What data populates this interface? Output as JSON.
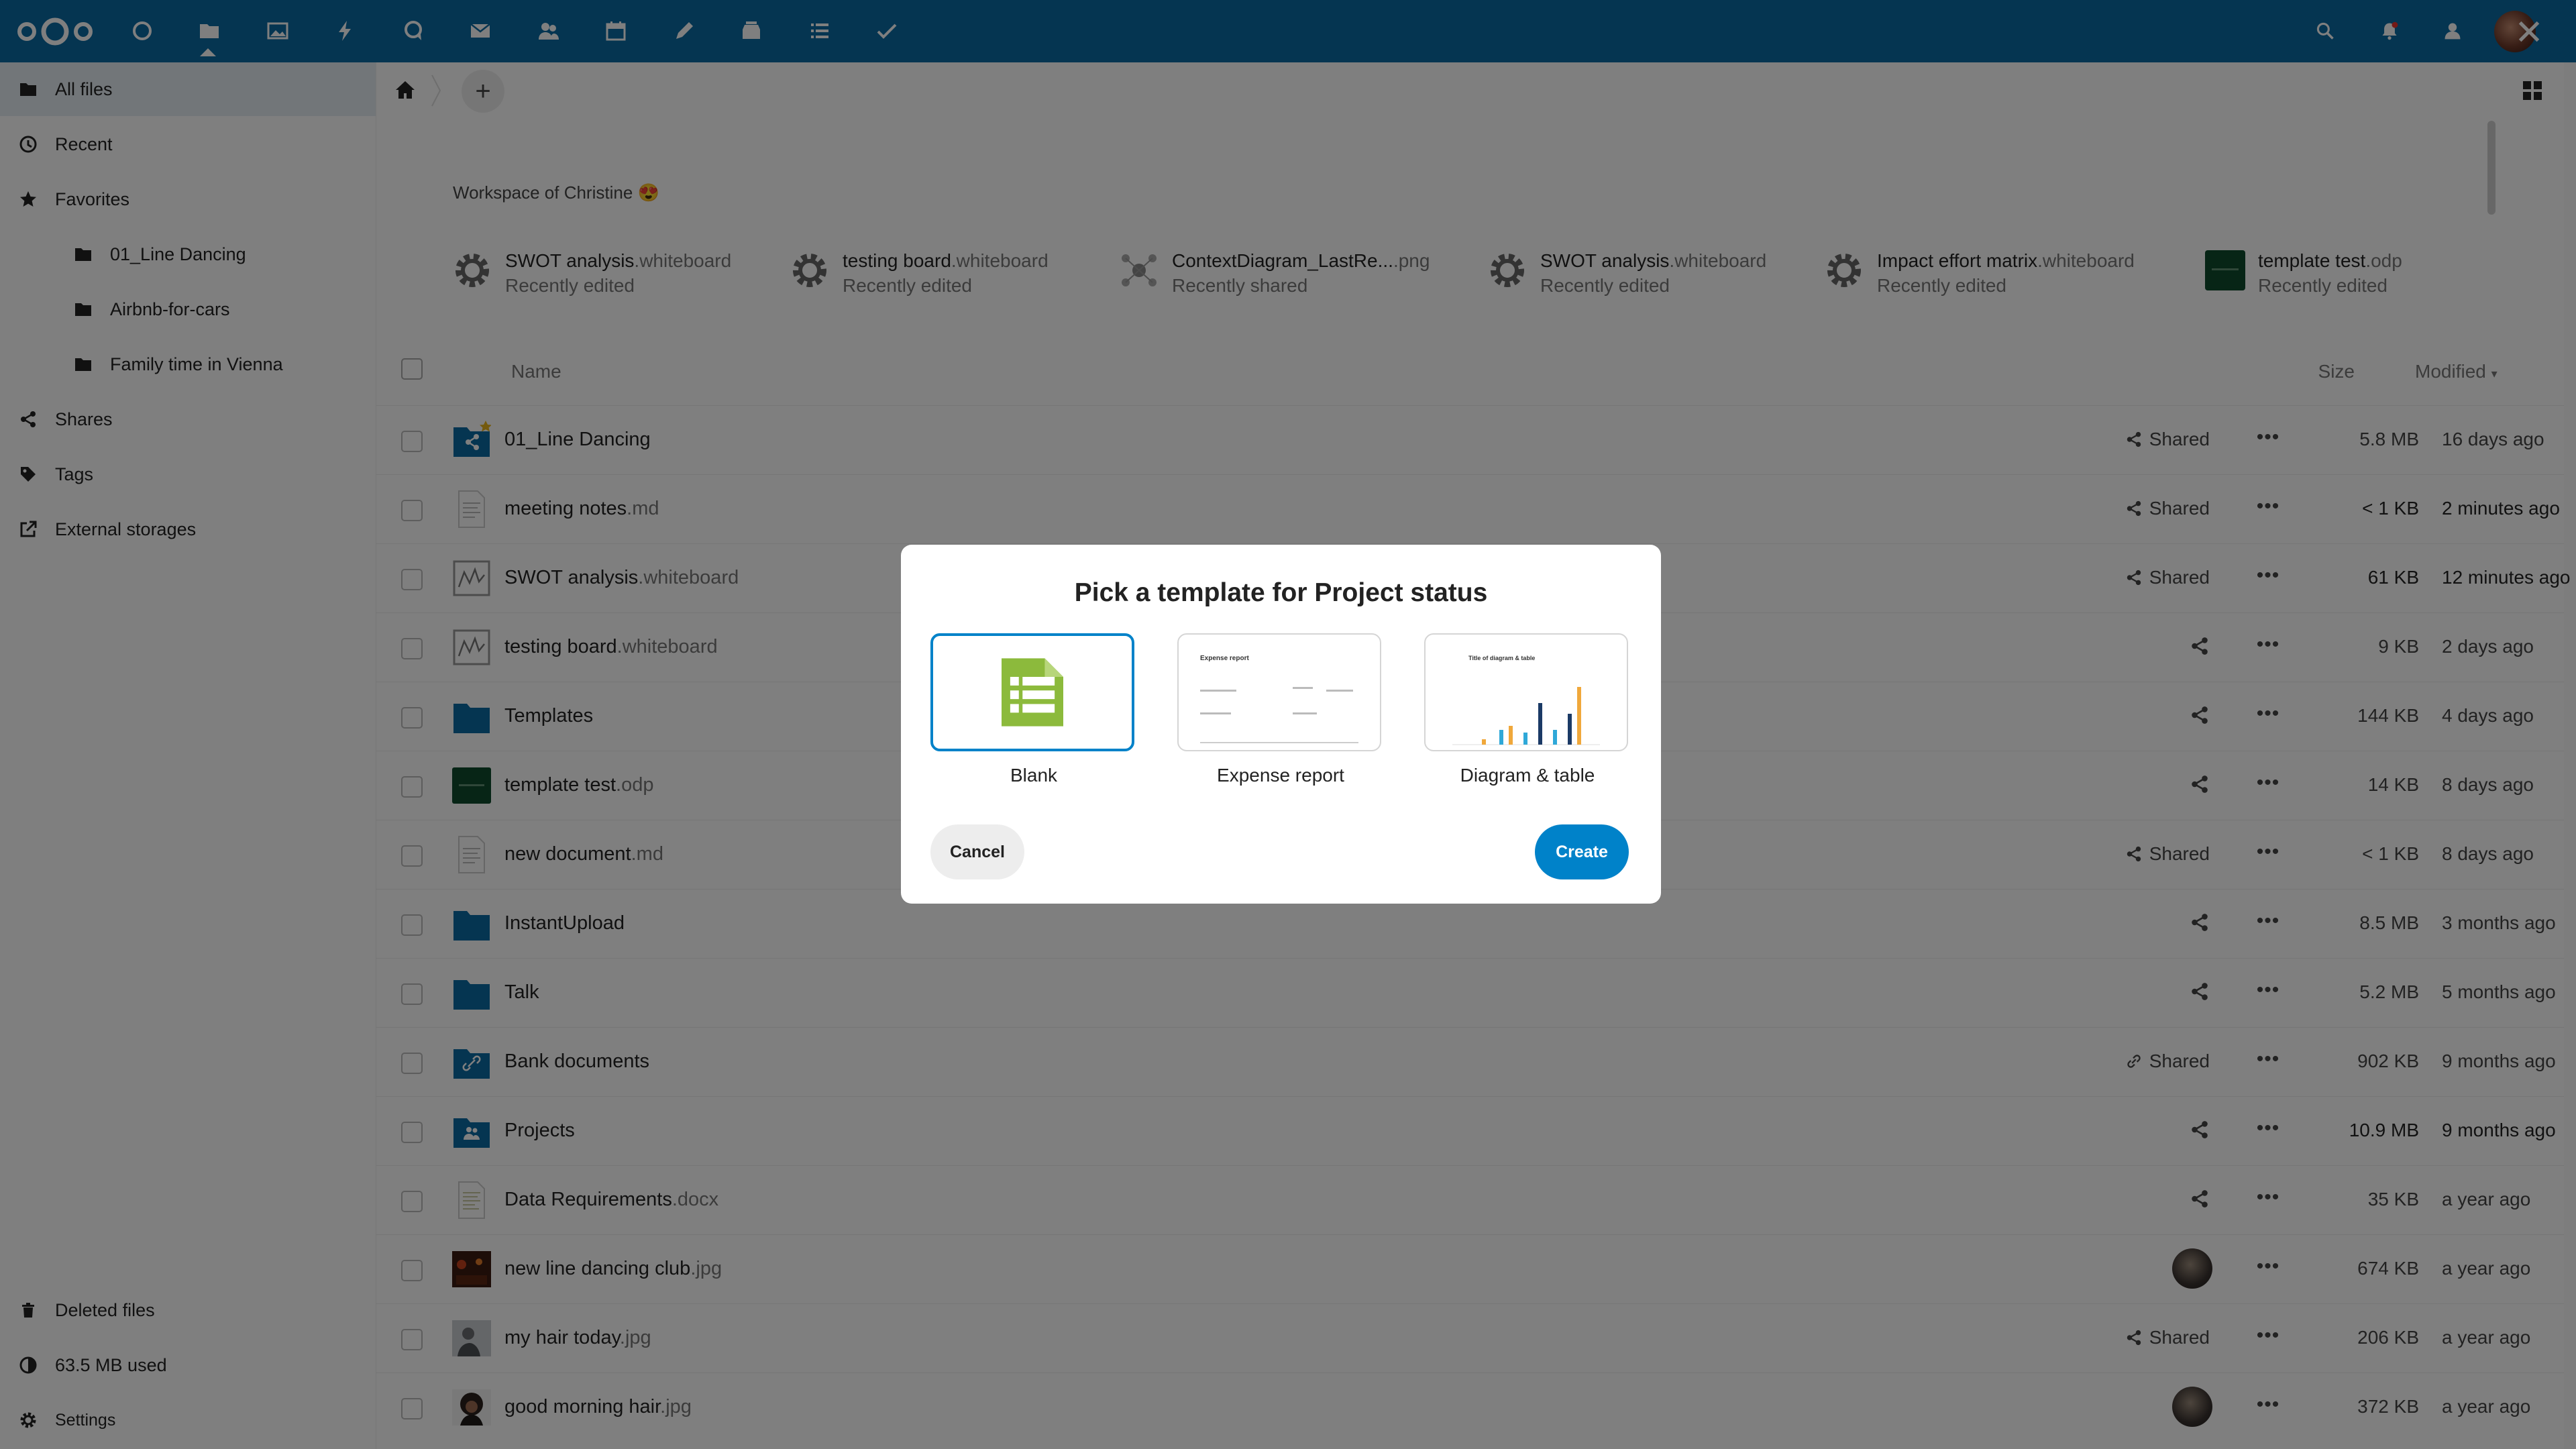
{
  "sidebar": {
    "items": [
      {
        "label": "All files",
        "icon": "folder-icon"
      },
      {
        "label": "Recent",
        "icon": "clock-icon"
      },
      {
        "label": "Favorites",
        "icon": "star-icon"
      },
      {
        "label": "01_Line Dancing",
        "icon": "folder-icon"
      },
      {
        "label": "Airbnb-for-cars",
        "icon": "folder-icon"
      },
      {
        "label": "Family time in Vienna",
        "icon": "folder-icon"
      },
      {
        "label": "Shares",
        "icon": "share-icon"
      },
      {
        "label": "Tags",
        "icon": "tag-icon"
      },
      {
        "label": "External storages",
        "icon": "external-link-icon"
      }
    ],
    "bottom": {
      "deleted": "Deleted files",
      "quota": "63.5 MB used",
      "settings": "Settings"
    }
  },
  "workspace": {
    "title": "Workspace of Christine 😍"
  },
  "recent": [
    {
      "name": "SWOT analysis",
      "ext": ".whiteboard",
      "status": "Recently edited"
    },
    {
      "name": "testing board",
      "ext": ".whiteboard",
      "status": "Recently edited"
    },
    {
      "name": "ContextDiagram_LastRe...",
      "ext": ".png",
      "status": "Recently shared"
    },
    {
      "name": "SWOT analysis",
      "ext": ".whiteboard",
      "status": "Recently edited"
    },
    {
      "name": "Impact effort matrix",
      "ext": ".whiteboard",
      "status": "Recently edited"
    },
    {
      "name": "template test",
      "ext": ".odp",
      "status": "Recently edited"
    }
  ],
  "list_header": {
    "name": "Name",
    "size": "Size",
    "modified": "Modified"
  },
  "files": [
    {
      "name": "01_Line Dancing",
      "ext": "",
      "shared": "Shared",
      "size": "5.8 MB",
      "modified": "16 days ago"
    },
    {
      "name": "meeting notes",
      "ext": ".md",
      "shared": "Shared",
      "size": "< 1 KB",
      "modified": "2 minutes ago"
    },
    {
      "name": "SWOT analysis",
      "ext": ".whiteboard",
      "shared": "Shared",
      "size": "61 KB",
      "modified": "12 minutes ago"
    },
    {
      "name": "testing board",
      "ext": ".whiteboard",
      "shared": "",
      "size": "9 KB",
      "modified": "2 days ago"
    },
    {
      "name": "Templates",
      "ext": "",
      "shared": "",
      "size": "144 KB",
      "modified": "4 days ago"
    },
    {
      "name": "template test",
      "ext": ".odp",
      "shared": "",
      "size": "14 KB",
      "modified": "8 days ago"
    },
    {
      "name": "new document",
      "ext": ".md",
      "shared": "Shared",
      "size": "< 1 KB",
      "modified": "8 days ago"
    },
    {
      "name": "InstantUpload",
      "ext": "",
      "shared": "",
      "size": "8.5 MB",
      "modified": "3 months ago"
    },
    {
      "name": "Talk",
      "ext": "",
      "shared": "",
      "size": "5.2 MB",
      "modified": "5 months ago"
    },
    {
      "name": "Bank documents",
      "ext": "",
      "shared": "Shared",
      "size": "902 KB",
      "modified": "9 months ago"
    },
    {
      "name": "Projects",
      "ext": "",
      "shared": "",
      "size": "10.9 MB",
      "modified": "9 months ago"
    },
    {
      "name": "Data Requirements",
      "ext": ".docx",
      "shared": "",
      "size": "35 KB",
      "modified": "a year ago"
    },
    {
      "name": "new line dancing club",
      "ext": ".jpg",
      "shared": "",
      "size": "674 KB",
      "modified": "a year ago"
    },
    {
      "name": "my hair today",
      "ext": ".jpg",
      "shared": "Shared",
      "size": "206 KB",
      "modified": "a year ago"
    },
    {
      "name": "good morning hair",
      "ext": ".jpg",
      "shared": "",
      "size": "372 KB",
      "modified": "a year ago"
    }
  ],
  "modal": {
    "title": "Pick a template for Project status",
    "templates": [
      {
        "label": "Blank",
        "preview_title": ""
      },
      {
        "label": "Expense report",
        "preview_title": "Expense report"
      },
      {
        "label": "Diagram & table",
        "preview_title": "Title of diagram & table"
      }
    ],
    "cancel": "Cancel",
    "create": "Create"
  },
  "colors": {
    "header": "#0a6aa3",
    "primary": "#0082c9",
    "folder": "#0a6aa3",
    "spreadsheet": "#8cba3c"
  }
}
